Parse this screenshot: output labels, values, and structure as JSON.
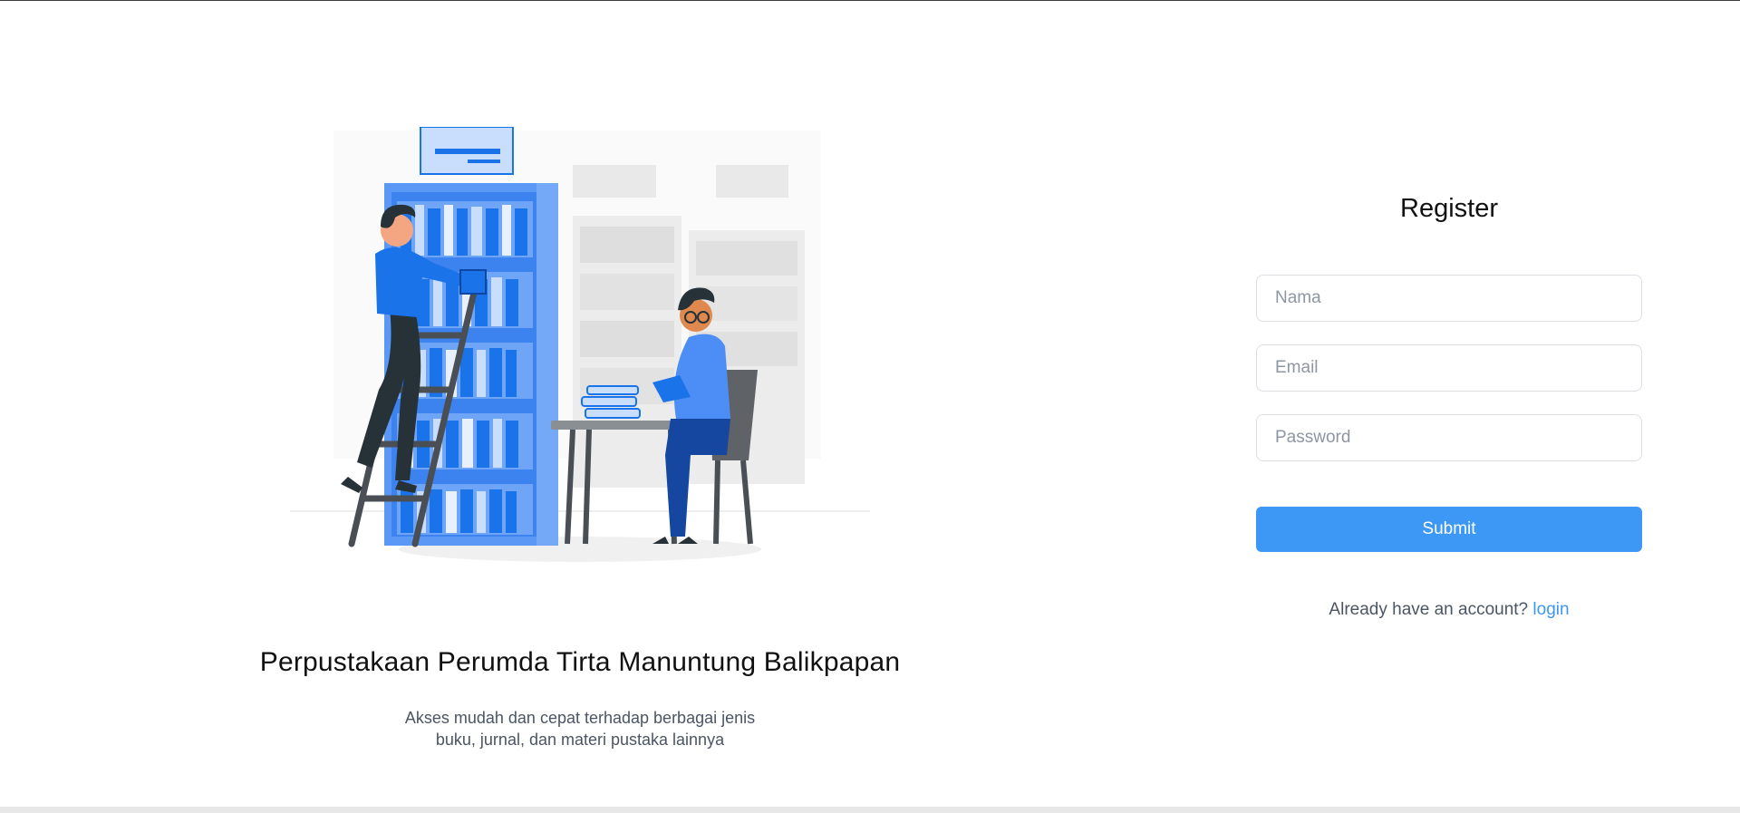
{
  "hero": {
    "illustration_icon": "library-illustration",
    "title": "Perpustakaan Perumda Tirta Manuntung Balikpapan",
    "subtitle_line1": "Akses mudah dan cepat terhadap berbagai jenis",
    "subtitle_line2": "buku, jurnal, dan materi pustaka lainnya"
  },
  "register_form": {
    "title": "Register",
    "fields": [
      {
        "name": "nama",
        "placeholder": "Nama",
        "value": ""
      },
      {
        "name": "email",
        "placeholder": "Email",
        "value": ""
      },
      {
        "name": "password",
        "placeholder": "Password",
        "value": ""
      }
    ],
    "submit_label": "Submit",
    "login_prompt": "Already have an account?",
    "login_link": "login"
  },
  "colors": {
    "accent": "#3d98f5",
    "illustration_blue": "#1a73e8",
    "illustration_light_blue": "#74a9f7",
    "muted_text": "#4b5563"
  }
}
